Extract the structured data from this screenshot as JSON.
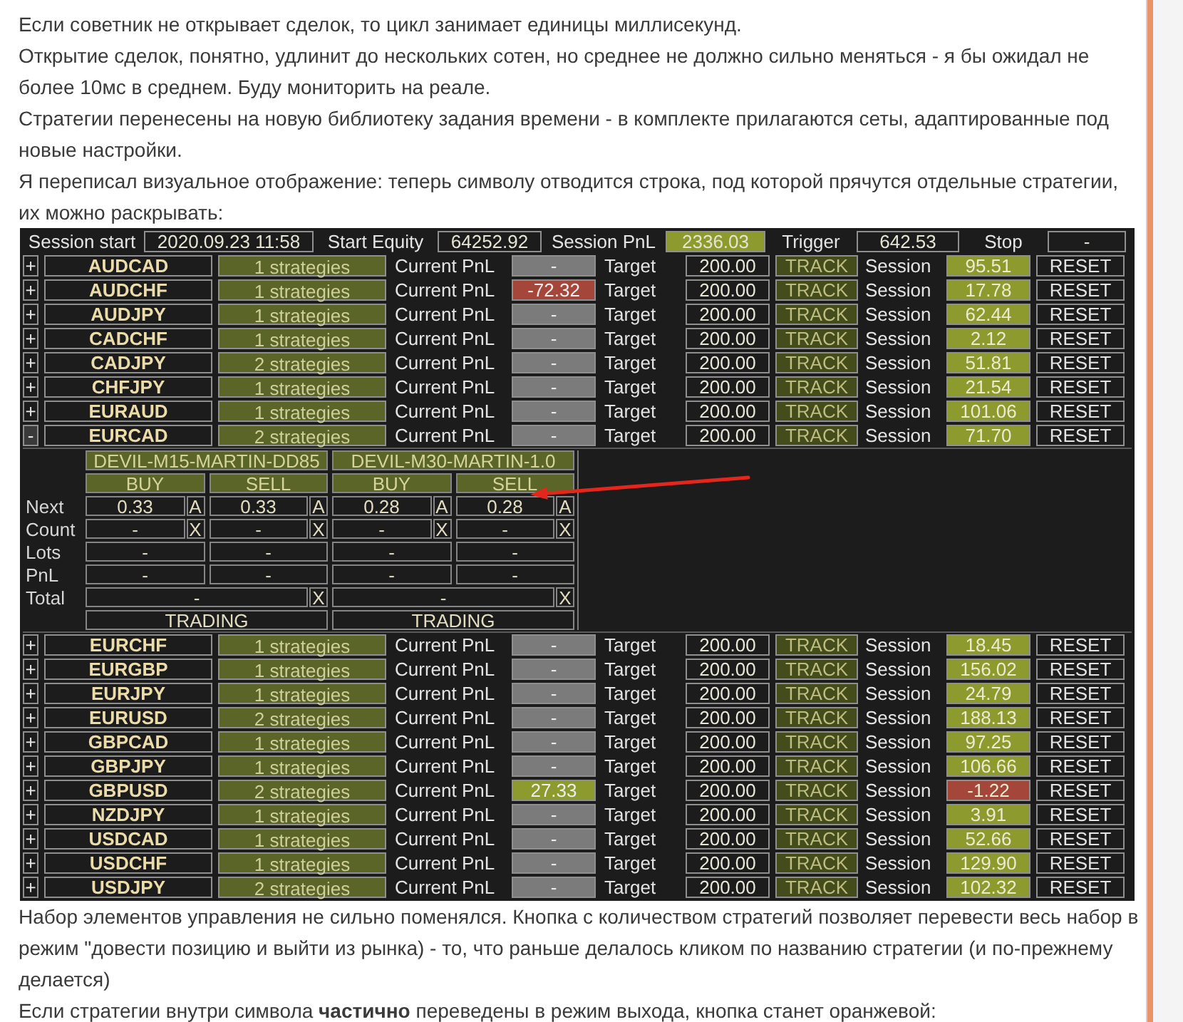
{
  "intro": [
    "Если советник не открывает сделок, то цикл занимает единицы миллисекунд.",
    "Открытие сделок, понятно, удлинит до нескольких сотен, но среднее не должно сильно меняться - я бы ожидал не более 10мс в среднем. Буду мониторить на реале.",
    "Стратегии перенесены на новую библиотеку задания времени - в комплекте прилагаются сеты, адаптированные под новые настройки.",
    "Я переписал визуальное отображение: теперь символу отводится строка, под которой прячутся отдельные стратегии, их можно раскрывать:"
  ],
  "panel": {
    "header": [
      {
        "label": "Session start",
        "value": "2020.09.23 11:58",
        "color": "#1c1c1c"
      },
      {
        "label": "Start Equity",
        "value": "64252.92",
        "color": "#1c1c1c"
      },
      {
        "label": "Session PnL",
        "value": "2336.03",
        "color": "#8c9a2e"
      },
      {
        "label": "Trigger",
        "value": "642.53",
        "color": "#1c1c1c"
      },
      {
        "label": "Stop",
        "value": "-",
        "color": "#1c1c1c"
      }
    ],
    "symbols": [
      {
        "toggle": "+",
        "expanded": false,
        "name": "AUDCAD",
        "strategies": "1 strategies",
        "pnl_label": "Current PnL",
        "pnl": {
          "text": "-",
          "color": "#7b7b7b"
        },
        "target_label": "Target",
        "target": "200.00",
        "track": "TRACK",
        "session_label": "Session",
        "session": {
          "text": "95.51",
          "color": "#8c9a2e"
        },
        "reset": "RESET"
      },
      {
        "toggle": "+",
        "expanded": false,
        "name": "AUDCHF",
        "strategies": "1 strategies",
        "pnl_label": "Current PnL",
        "pnl": {
          "text": "-72.32",
          "color": "#a4473a"
        },
        "target_label": "Target",
        "target": "200.00",
        "track": "TRACK",
        "session_label": "Session",
        "session": {
          "text": "17.78",
          "color": "#8c9a2e"
        },
        "reset": "RESET"
      },
      {
        "toggle": "+",
        "expanded": false,
        "name": "AUDJPY",
        "strategies": "1 strategies",
        "pnl_label": "Current PnL",
        "pnl": {
          "text": "-",
          "color": "#7b7b7b"
        },
        "target_label": "Target",
        "target": "200.00",
        "track": "TRACK",
        "session_label": "Session",
        "session": {
          "text": "62.44",
          "color": "#8c9a2e"
        },
        "reset": "RESET"
      },
      {
        "toggle": "+",
        "expanded": false,
        "name": "CADCHF",
        "strategies": "1 strategies",
        "pnl_label": "Current PnL",
        "pnl": {
          "text": "-",
          "color": "#7b7b7b"
        },
        "target_label": "Target",
        "target": "200.00",
        "track": "TRACK",
        "session_label": "Session",
        "session": {
          "text": "2.12",
          "color": "#8c9a2e"
        },
        "reset": "RESET"
      },
      {
        "toggle": "+",
        "expanded": false,
        "name": "CADJPY",
        "strategies": "2 strategies",
        "pnl_label": "Current PnL",
        "pnl": {
          "text": "-",
          "color": "#7b7b7b"
        },
        "target_label": "Target",
        "target": "200.00",
        "track": "TRACK",
        "session_label": "Session",
        "session": {
          "text": "51.81",
          "color": "#8c9a2e"
        },
        "reset": "RESET"
      },
      {
        "toggle": "+",
        "expanded": false,
        "name": "CHFJPY",
        "strategies": "1 strategies",
        "pnl_label": "Current PnL",
        "pnl": {
          "text": "-",
          "color": "#7b7b7b"
        },
        "target_label": "Target",
        "target": "200.00",
        "track": "TRACK",
        "session_label": "Session",
        "session": {
          "text": "21.54",
          "color": "#8c9a2e"
        },
        "reset": "RESET"
      },
      {
        "toggle": "+",
        "expanded": false,
        "name": "EURAUD",
        "strategies": "1 strategies",
        "pnl_label": "Current PnL",
        "pnl": {
          "text": "-",
          "color": "#7b7b7b"
        },
        "target_label": "Target",
        "target": "200.00",
        "track": "TRACK",
        "session_label": "Session",
        "session": {
          "text": "101.06",
          "color": "#8c9a2e"
        },
        "reset": "RESET"
      },
      {
        "toggle": "-",
        "expanded": true,
        "name": "EURCAD",
        "strategies": "2 strategies",
        "pnl_label": "Current PnL",
        "pnl": {
          "text": "-",
          "color": "#7b7b7b"
        },
        "target_label": "Target",
        "target": "200.00",
        "track": "TRACK",
        "session_label": "Session",
        "session": {
          "text": "71.70",
          "color": "#8c9a2e"
        },
        "reset": "RESET",
        "details": {
          "row_labels": [
            "Next",
            "Count",
            "Lots",
            "PnL",
            "Total"
          ],
          "strategies": [
            {
              "name": "DEVIL-M15-MARTIN-DD85",
              "sides": [
                {
                  "label": "BUY",
                  "next": "0.33",
                  "next_flag": "A",
                  "count": "-",
                  "count_flag": "X",
                  "lots": "-",
                  "pnl": "-"
                },
                {
                  "label": "SELL",
                  "next": "0.33",
                  "next_flag": "A",
                  "count": "-",
                  "count_flag": "X",
                  "lots": "-",
                  "pnl": "-"
                }
              ],
              "total": "-",
              "total_flag": "X",
              "status": "TRADING"
            },
            {
              "name": "DEVIL-M30-MARTIN-1.0",
              "sides": [
                {
                  "label": "BUY",
                  "next": "0.28",
                  "next_flag": "A",
                  "count": "-",
                  "count_flag": "X",
                  "lots": "-",
                  "pnl": "-"
                },
                {
                  "label": "SELL",
                  "next": "0.28",
                  "next_flag": "A",
                  "count": "-",
                  "count_flag": "X",
                  "lots": "-",
                  "pnl": "-"
                }
              ],
              "total": "-",
              "total_flag": "X",
              "status": "TRADING"
            }
          ]
        }
      },
      {
        "toggle": "+",
        "expanded": false,
        "name": "EURCHF",
        "strategies": "1 strategies",
        "pnl_label": "Current PnL",
        "pnl": {
          "text": "-",
          "color": "#7b7b7b"
        },
        "target_label": "Target",
        "target": "200.00",
        "track": "TRACK",
        "session_label": "Session",
        "session": {
          "text": "18.45",
          "color": "#8c9a2e"
        },
        "reset": "RESET"
      },
      {
        "toggle": "+",
        "expanded": false,
        "name": "EURGBP",
        "strategies": "1 strategies",
        "pnl_label": "Current PnL",
        "pnl": {
          "text": "-",
          "color": "#7b7b7b"
        },
        "target_label": "Target",
        "target": "200.00",
        "track": "TRACK",
        "session_label": "Session",
        "session": {
          "text": "156.02",
          "color": "#8c9a2e"
        },
        "reset": "RESET"
      },
      {
        "toggle": "+",
        "expanded": false,
        "name": "EURJPY",
        "strategies": "1 strategies",
        "pnl_label": "Current PnL",
        "pnl": {
          "text": "-",
          "color": "#7b7b7b"
        },
        "target_label": "Target",
        "target": "200.00",
        "track": "TRACK",
        "session_label": "Session",
        "session": {
          "text": "24.79",
          "color": "#8c9a2e"
        },
        "reset": "RESET"
      },
      {
        "toggle": "+",
        "expanded": false,
        "name": "EURUSD",
        "strategies": "2 strategies",
        "pnl_label": "Current PnL",
        "pnl": {
          "text": "-",
          "color": "#7b7b7b"
        },
        "target_label": "Target",
        "target": "200.00",
        "track": "TRACK",
        "session_label": "Session",
        "session": {
          "text": "188.13",
          "color": "#8c9a2e"
        },
        "reset": "RESET"
      },
      {
        "toggle": "+",
        "expanded": false,
        "name": "GBPCAD",
        "strategies": "1 strategies",
        "pnl_label": "Current PnL",
        "pnl": {
          "text": "-",
          "color": "#7b7b7b"
        },
        "target_label": "Target",
        "target": "200.00",
        "track": "TRACK",
        "session_label": "Session",
        "session": {
          "text": "97.25",
          "color": "#8c9a2e"
        },
        "reset": "RESET"
      },
      {
        "toggle": "+",
        "expanded": false,
        "name": "GBPJPY",
        "strategies": "1 strategies",
        "pnl_label": "Current PnL",
        "pnl": {
          "text": "-",
          "color": "#7b7b7b"
        },
        "target_label": "Target",
        "target": "200.00",
        "track": "TRACK",
        "session_label": "Session",
        "session": {
          "text": "106.66",
          "color": "#8c9a2e"
        },
        "reset": "RESET"
      },
      {
        "toggle": "+",
        "expanded": false,
        "name": "GBPUSD",
        "strategies": "2 strategies",
        "pnl_label": "Current PnL",
        "pnl": {
          "text": "27.33",
          "color": "#8c9a2e"
        },
        "target_label": "Target",
        "target": "200.00",
        "track": "TRACK",
        "session_label": "Session",
        "session": {
          "text": "-1.22",
          "color": "#a4473a"
        },
        "reset": "RESET"
      },
      {
        "toggle": "+",
        "expanded": false,
        "name": "NZDJPY",
        "strategies": "1 strategies",
        "pnl_label": "Current PnL",
        "pnl": {
          "text": "-",
          "color": "#7b7b7b"
        },
        "target_label": "Target",
        "target": "200.00",
        "track": "TRACK",
        "session_label": "Session",
        "session": {
          "text": "3.91",
          "color": "#8c9a2e"
        },
        "reset": "RESET"
      },
      {
        "toggle": "+",
        "expanded": false,
        "name": "USDCAD",
        "strategies": "1 strategies",
        "pnl_label": "Current PnL",
        "pnl": {
          "text": "-",
          "color": "#7b7b7b"
        },
        "target_label": "Target",
        "target": "200.00",
        "track": "TRACK",
        "session_label": "Session",
        "session": {
          "text": "52.66",
          "color": "#8c9a2e"
        },
        "reset": "RESET"
      },
      {
        "toggle": "+",
        "expanded": false,
        "name": "USDCHF",
        "strategies": "1 strategies",
        "pnl_label": "Current PnL",
        "pnl": {
          "text": "-",
          "color": "#7b7b7b"
        },
        "target_label": "Target",
        "target": "200.00",
        "track": "TRACK",
        "session_label": "Session",
        "session": {
          "text": "129.90",
          "color": "#8c9a2e"
        },
        "reset": "RESET"
      },
      {
        "toggle": "+",
        "expanded": false,
        "name": "USDJPY",
        "strategies": "2 strategies",
        "pnl_label": "Current PnL",
        "pnl": {
          "text": "-",
          "color": "#7b7b7b"
        },
        "target_label": "Target",
        "target": "200.00",
        "track": "TRACK",
        "session_label": "Session",
        "session": {
          "text": "102.32",
          "color": "#8c9a2e"
        },
        "reset": "RESET"
      }
    ]
  },
  "outro": [
    "Набор элементов управления не сильно поменялся. Кнопка с количеством стратегий позволяет перевести весь набор в режим \"довести позицию и выйти из рынка) - то, что раньше делалось кликом по названию стратегии (и по-прежнему делается)",
    "Если стратегии внутри символа **частично** переведены в режим выхода, кнопка станет оранжевой:"
  ]
}
